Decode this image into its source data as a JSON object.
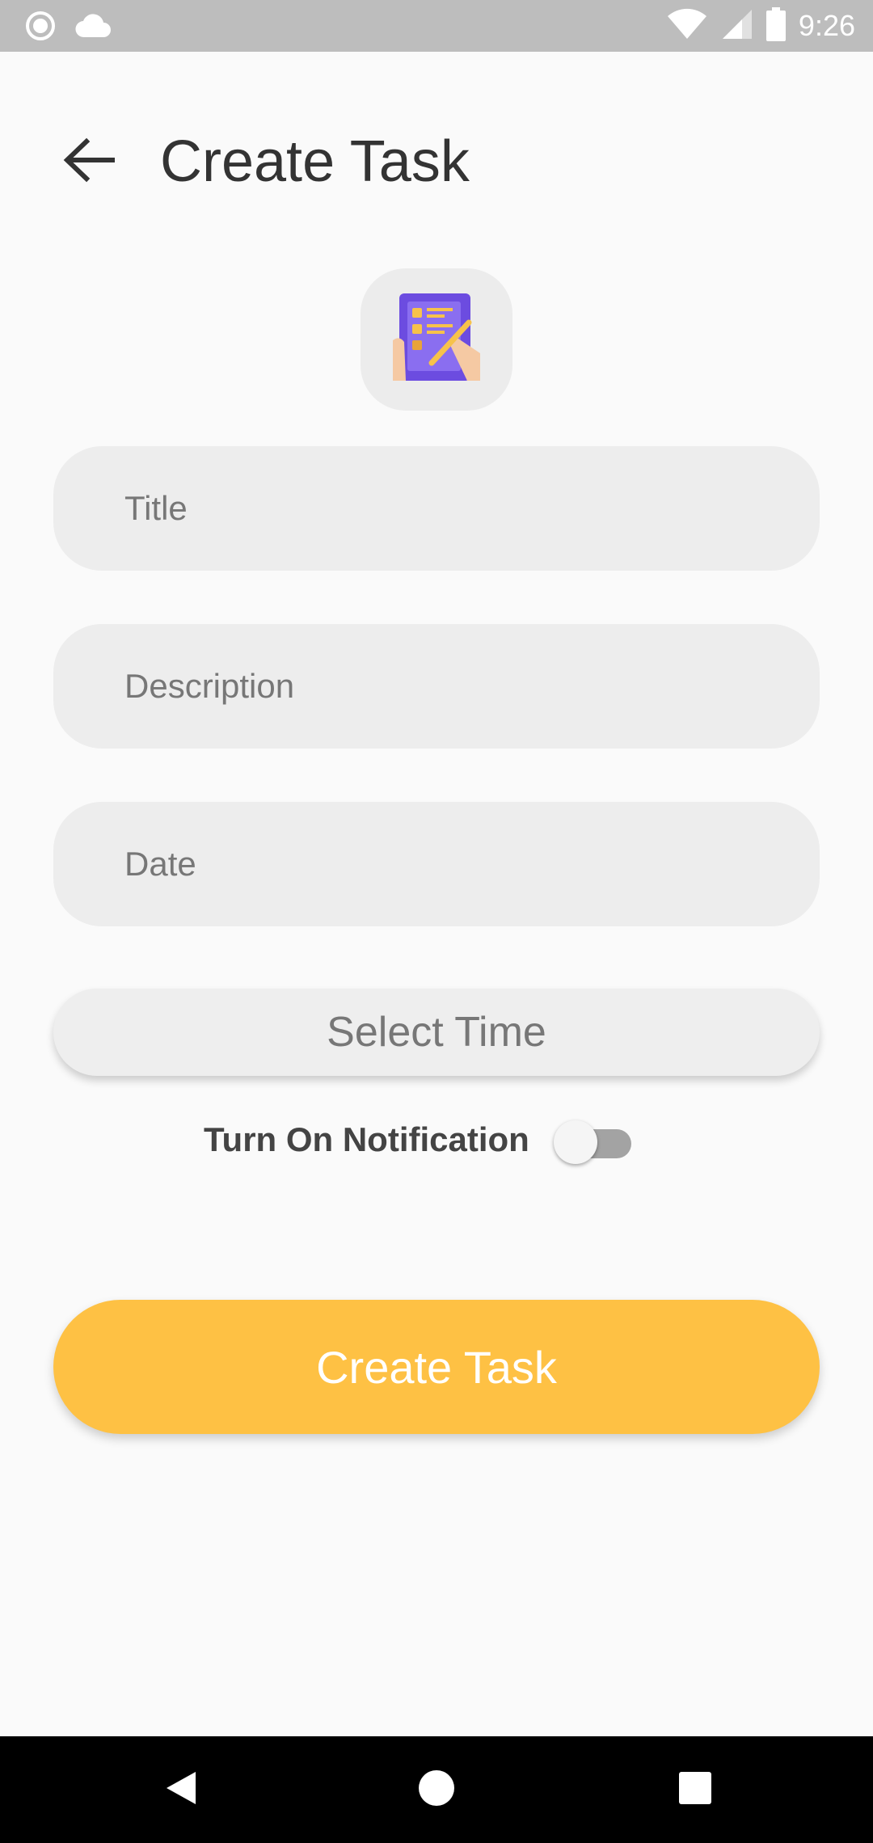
{
  "status_bar": {
    "time": "9:26",
    "icons": [
      "record-icon",
      "cloud-icon",
      "wifi-icon",
      "signal-icon",
      "battery-icon"
    ]
  },
  "header": {
    "title": "Create Task",
    "back_icon": "arrow-left-icon"
  },
  "app_icon": "task-checklist-icon",
  "form": {
    "title_placeholder": "Title",
    "description_placeholder": "Description",
    "date_placeholder": "Date",
    "select_time_label": "Select Time",
    "notification_label": "Turn On Notification",
    "notification_on": false,
    "submit_label": "Create Task"
  },
  "colors": {
    "accent": "#fec144",
    "field_bg": "#ededed",
    "page_bg": "#fafafa",
    "title_text": "#333333"
  },
  "nav_bar": {
    "buttons": [
      "back-triangle-icon",
      "home-circle-icon",
      "recents-square-icon"
    ]
  }
}
